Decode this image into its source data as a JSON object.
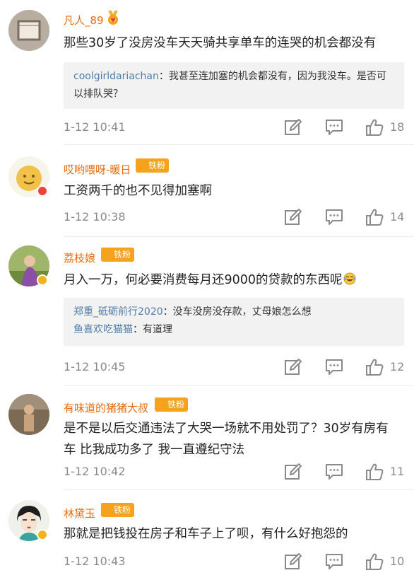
{
  "comments": [
    {
      "user": "凡人_89",
      "text": "那些30岁了没房没车天天骑共享单车的连哭的机会都没有",
      "replies": [
        {
          "name": "coolgirldariachan",
          "text": "：我甚至连加塞的机会都没有，因为我没车。是否可以排队哭？"
        }
      ],
      "time": "1-12 10:41",
      "likes": "18"
    },
    {
      "user": "哎哟喂呀-暖日",
      "fan_badge": "铁粉",
      "text": "工资两千的也不见得加塞啊",
      "time": "1-12 10:38",
      "likes": "14"
    },
    {
      "user": "荔枝娘",
      "fan_badge": "铁粉",
      "text": "月入一万，何必要消费每月还9000的贷款的东西呢",
      "emoji": "laughing-tears-emoji",
      "replies": [
        {
          "name": "郑重_砥砺前行2020",
          "text": "：没车没房没存款，丈母娘怎么想"
        },
        {
          "name": "鱼喜欢吃猫猫",
          "text": "：有道理"
        }
      ],
      "time": "1-12 10:45",
      "likes": "12"
    },
    {
      "user": "有味道的猪猪大叔",
      "fan_badge": "铁粉",
      "text_lines": [
        "是不是以后交通违法了大哭一场就不用处罚了？30岁有房有",
        "车 比我成功多了 我一直遵纪守法"
      ],
      "time": "1-12 10:42",
      "likes": "11"
    },
    {
      "user": "林黛玉",
      "fan_badge": "铁粉",
      "text": "那就是把钱投在房子和车子上了呗，有什么好抱怨的",
      "time": "1-12 10:43",
      "likes": "10"
    }
  ],
  "colors": {
    "username": "#e86b0f",
    "reply_name": "#4f7ca8",
    "fan_badge": "#f6a21c",
    "meta": "#8a8a8a"
  },
  "icons": [
    "medal-icon",
    "edit-icon",
    "comment-icon",
    "like-icon"
  ]
}
